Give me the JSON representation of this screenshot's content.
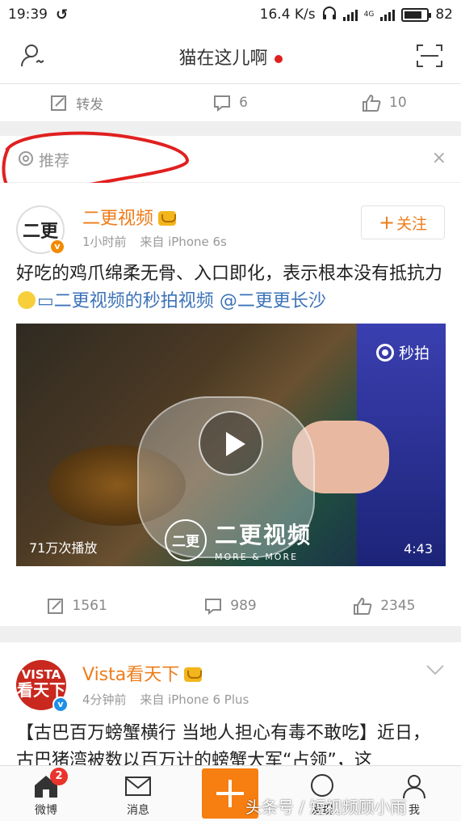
{
  "status_bar": {
    "time": "19:39",
    "network_speed": "16.4 K/s",
    "network_type": "4G",
    "battery": "82"
  },
  "nav": {
    "title": "猫在这儿啊"
  },
  "prev_post_actions": {
    "repost_label": "转发",
    "comment_count": "6",
    "like_count": "10"
  },
  "recommend": {
    "label": "推荐",
    "close": "×"
  },
  "post1": {
    "author": "二更视频",
    "avatar_text": "二更",
    "time": "1小时前",
    "source": "来自 iPhone 6s",
    "follow_label": "关注",
    "text_plain": "好吃的鸡爪绵柔无骨、入口即化，表示根本没有抵抗力",
    "video_link": "二更视频的秒拍视频",
    "mention": "@二更更长沙",
    "video": {
      "brand": "秒拍",
      "watermark_cn": "二更视频",
      "watermark_en": "MORE & MORE",
      "watermark_logo": "二更",
      "plays": "71万次播放",
      "duration": "4:43"
    },
    "repost_count": "1561",
    "comment_count": "989",
    "like_count": "2345"
  },
  "post2": {
    "author": "Vista看天下",
    "avatar_top": "VISTA",
    "avatar_bottom": "看天下",
    "time": "4分钟前",
    "source": "来自 iPhone 6 Plus",
    "text": "【古巴百万螃蟹横行 当地人担心有毒不敢吃】近日，古巴猪湾被数以百万计的螃蟹大军“占领”，这"
  },
  "tabbar": {
    "home": "微博",
    "home_badge": "2",
    "messages": "消息",
    "discover": "发现",
    "me": "我"
  },
  "watermark": "头条号 / 短视频顾小雨",
  "colors": {
    "accent": "#ee7c1a",
    "link": "#3c73b8",
    "compose": "#f77e10",
    "annotation_red": "#e0201f"
  }
}
